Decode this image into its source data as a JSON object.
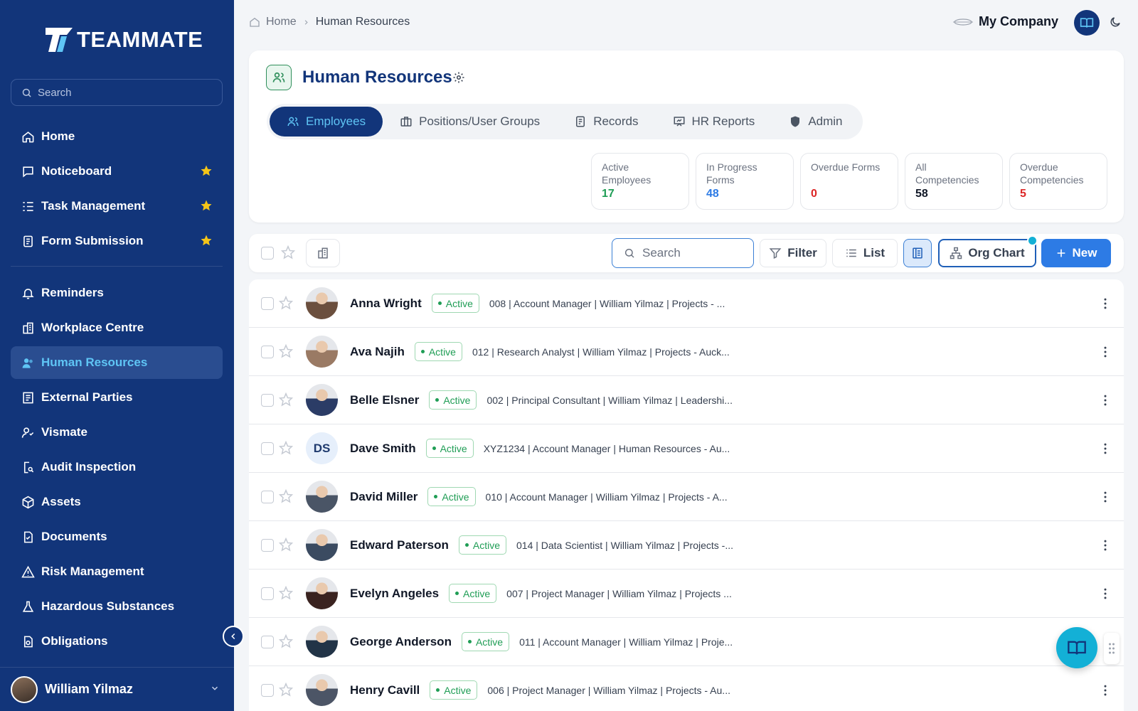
{
  "brand": {
    "name": "TEAMMATE"
  },
  "sidebar": {
    "search_placeholder": "Search",
    "items": [
      {
        "label": "Home",
        "icon": "home-icon",
        "starred": false
      },
      {
        "label": "Noticeboard",
        "icon": "message-square-icon",
        "starred": true
      },
      {
        "label": "Task Management",
        "icon": "list-checks-icon",
        "starred": true
      },
      {
        "label": "Form Submission",
        "icon": "form-icon",
        "starred": true
      }
    ],
    "items2": [
      {
        "label": "Reminders",
        "icon": "bell-icon"
      },
      {
        "label": "Workplace Centre",
        "icon": "building-icon"
      },
      {
        "label": "Human Resources",
        "icon": "users-icon",
        "active": true
      },
      {
        "label": "External Parties",
        "icon": "contacts-icon"
      },
      {
        "label": "Vismate",
        "icon": "user-check-icon"
      },
      {
        "label": "Audit Inspection",
        "icon": "file-search-icon"
      },
      {
        "label": "Assets",
        "icon": "box-icon"
      },
      {
        "label": "Documents",
        "icon": "document-icon"
      },
      {
        "label": "Risk Management",
        "icon": "warning-icon"
      },
      {
        "label": "Hazardous Substances",
        "icon": "flask-icon"
      },
      {
        "label": "Obligations",
        "icon": "file-check-icon"
      }
    ],
    "user": {
      "name": "William Yilmaz"
    }
  },
  "breadcrumb": {
    "home": "Home",
    "current": "Human Resources"
  },
  "company": {
    "name": "My Company"
  },
  "header": {
    "title": "Human Resources",
    "tabs": [
      {
        "label": "Employees",
        "icon": "users-icon",
        "active": true
      },
      {
        "label": "Positions/User Groups",
        "icon": "briefcase-icon"
      },
      {
        "label": "Records",
        "icon": "records-icon"
      },
      {
        "label": "HR Reports",
        "icon": "presentation-icon"
      },
      {
        "label": "Admin",
        "icon": "shield-icon"
      }
    ],
    "stats": [
      {
        "label": "Active Employees",
        "value": "17",
        "color": "#1f9d55"
      },
      {
        "label": "In Progress Forms",
        "value": "48",
        "color": "#2d7be5"
      },
      {
        "label": "Overdue Forms",
        "value": "0",
        "color": "#dc2626"
      },
      {
        "label": "All Competencies",
        "value": "58",
        "color": "#111827"
      },
      {
        "label": "Overdue Competencies",
        "value": "5",
        "color": "#dc2626"
      }
    ]
  },
  "toolbar": {
    "search_placeholder": "Search",
    "filter_label": "Filter",
    "list_label": "List",
    "org_chart_label": "Org Chart",
    "new_label": "New"
  },
  "employees": [
    {
      "name": "Anna Wright",
      "status": "Active",
      "details": "008 | Account Manager | William Yilmaz | Projects - ...",
      "initials": "",
      "avatar_color": "#6b4f3e"
    },
    {
      "name": "Ava Najih",
      "status": "Active",
      "details": "012 | Research Analyst | William Yilmaz | Projects - Auck...",
      "initials": "",
      "avatar_color": "#9a7a64"
    },
    {
      "name": "Belle Elsner",
      "status": "Active",
      "details": "002 | Principal Consultant | William Yilmaz | Leadershi...",
      "initials": "",
      "avatar_color": "#2b3c66"
    },
    {
      "name": "Dave Smith",
      "status": "Active",
      "details": "XYZ1234 | Account Manager | Human Resources - Au...",
      "initials": "DS",
      "avatar_color": "#e6effb"
    },
    {
      "name": "David Miller",
      "status": "Active",
      "details": "010 | Account Manager | William Yilmaz | Projects - A...",
      "initials": "",
      "avatar_color": "#4a5566"
    },
    {
      "name": "Edward Paterson",
      "status": "Active",
      "details": "014 | Data Scientist | William Yilmaz | Projects -...",
      "initials": "",
      "avatar_color": "#3b4b61"
    },
    {
      "name": "Evelyn Angeles",
      "status": "Active",
      "details": "007 | Project Manager | William Yilmaz | Projects ...",
      "initials": "",
      "avatar_color": "#3a2320"
    },
    {
      "name": "George Anderson",
      "status": "Active",
      "details": "011 | Account Manager | William Yilmaz | Proje...",
      "initials": "",
      "avatar_color": "#223447"
    },
    {
      "name": "Henry Cavill",
      "status": "Active",
      "details": "006 | Project Manager | William Yilmaz | Projects - Au...",
      "initials": "",
      "avatar_color": "#4c5566"
    }
  ]
}
